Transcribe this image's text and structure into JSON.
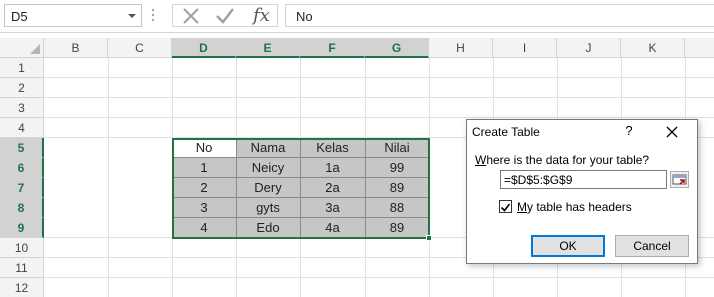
{
  "formula_bar": {
    "name_box": "D5",
    "fx_label": "fx",
    "formula": "No"
  },
  "columns": [
    "B",
    "C",
    "D",
    "E",
    "F",
    "G",
    "H",
    "I",
    "J",
    "K"
  ],
  "rows": [
    "1",
    "2",
    "3",
    "4",
    "5",
    "6",
    "7",
    "8",
    "9",
    "10",
    "11",
    "12"
  ],
  "table": {
    "headers": [
      "No",
      "Nama",
      "Kelas",
      "Nilai"
    ],
    "rows": [
      [
        "1",
        "Neicy",
        "1a",
        "99"
      ],
      [
        "2",
        "Dery",
        "2a",
        "89"
      ],
      [
        "3",
        "gyts",
        "3a",
        "88"
      ],
      [
        "4",
        "Edo",
        "4a",
        "89"
      ]
    ]
  },
  "dialog": {
    "title": "Create Table",
    "help": "?",
    "question_underlined": "W",
    "question_rest": "here is the data for your table?",
    "range": "=$D$5:$G$9",
    "checkbox_underlined": "M",
    "checkbox_rest": "y table has headers",
    "checkbox_checked": true,
    "ok_label": "OK",
    "cancel_label": "Cancel"
  },
  "colors": {
    "accent": "#217346",
    "shade": "#c6c6c6",
    "focus": "#0078d7"
  }
}
